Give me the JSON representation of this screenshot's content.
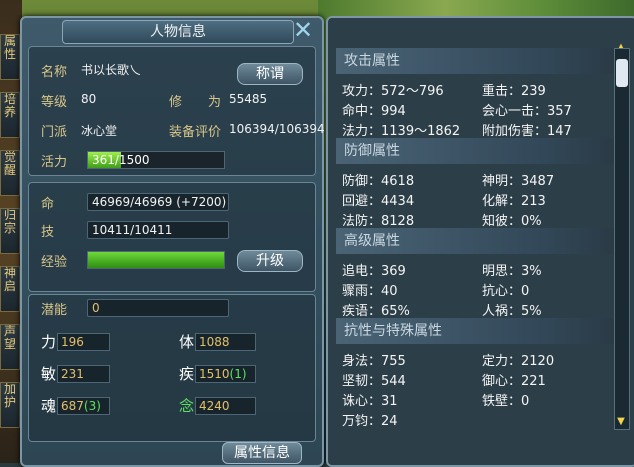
{
  "left_tabs": [
    "属性",
    "培养",
    "觉醒",
    "归宗",
    "神启",
    "声望",
    "加护"
  ],
  "panel": {
    "title": "人物信息",
    "name_label": "名称",
    "name_value": "书以长歌乀",
    "title_button": "称谓",
    "level_label": "等级",
    "level_value": "80",
    "cultivation_label": "修　　为",
    "cultivation_value": "55485",
    "sect_label": "门派",
    "sect_value": "冰心堂",
    "equip_label": "装备评价",
    "equip_value": "106394/106394",
    "vitality_label": "活力",
    "vitality_value": "361/1500",
    "vitality_fraction": 0.24,
    "life_label": "命",
    "life_value": "46969/46969 (+7200)",
    "skill_label": "技",
    "skill_value": "10411/10411",
    "exp_label": "经验",
    "exp_fraction": 1.0,
    "upgrade_button": "升级",
    "potential_label": "潜能",
    "potential_value": "0",
    "stats": {
      "str_label": "力",
      "str_value": "196",
      "con_label": "体",
      "con_value": "1088",
      "agi_label": "敏",
      "agi_value": "231",
      "spd_label": "疾",
      "spd_value": "1510",
      "spd_bonus": "(1)",
      "soul_label": "魂",
      "soul_value": "687",
      "soul_bonus": "(3)",
      "mind_label": "念",
      "mind_value": "4240"
    },
    "attr_button": "属性信息"
  },
  "attributes": {
    "attack_header": "攻击属性",
    "attack_rows": [
      [
        "攻力：572～796",
        "重击：239"
      ],
      [
        "命中：994",
        "会心一击：357"
      ],
      [
        "法力：1139～1862",
        "附加伤害：147"
      ]
    ],
    "defense_header": "防御属性",
    "defense_rows": [
      [
        "防御：4618",
        "神明：3487"
      ],
      [
        "回避：4434",
        "化解：213"
      ],
      [
        "法防：8128",
        "知彼：0%"
      ]
    ],
    "advanced_header": "高级属性",
    "advanced_rows": [
      [
        "追电：369",
        "明思：3%"
      ],
      [
        "骤雨：40",
        "抗心：0"
      ],
      [
        "疾语：65%",
        "人祸：5%"
      ]
    ],
    "special_header": "抗性与特殊属性",
    "special_rows": [
      [
        "身法：755",
        "定力：2120"
      ],
      [
        "坚韧：544",
        "御心：221"
      ],
      [
        "诛心：31",
        "铁壁：0"
      ],
      [
        "万钧：24",
        ""
      ]
    ]
  },
  "colors": {
    "label_gold": "#d9c68a",
    "bonus_green": "#5fe05f",
    "exp_green": "#4fc020"
  },
  "icons": {
    "close": "close-icon",
    "scroll_up": "arrow-up-icon",
    "scroll_down": "arrow-down-icon"
  }
}
